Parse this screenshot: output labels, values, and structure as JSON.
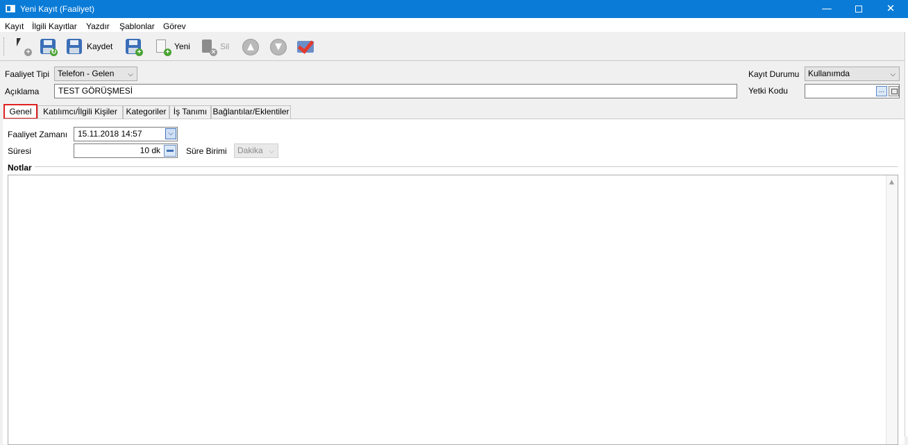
{
  "window": {
    "title": "Yeni Kayıt (Faaliyet)",
    "min": "—",
    "close": "✕"
  },
  "menu": [
    "Kayıt",
    "İlgili Kayıtlar",
    "Yazdır",
    "Şablonlar",
    "Görev"
  ],
  "toolbar": {
    "save_label": "Kaydet",
    "new_label": "Yeni",
    "delete_label": "Sil",
    "up": "▲",
    "down": "▼"
  },
  "header": {
    "activity_type_label": "Faaliyet Tipi",
    "activity_type_value": "Telefon - Gelen",
    "description_label": "Açıklama",
    "description_value": "TEST GÖRÜŞMESİ",
    "record_status_label": "Kayıt Durumu",
    "record_status_value": "Kullanımda",
    "auth_code_label": "Yetki Kodu",
    "auth_code_value": "",
    "dots": "..."
  },
  "tabs": [
    "Genel",
    "Katılımcı/İlgili Kişiler",
    "Kategoriler",
    "İş Tanımı",
    "Bağlantılar/Eklentiler"
  ],
  "general": {
    "activity_time_label": "Faaliyet Zamanı",
    "activity_time_value": "15.11.2018 14:57",
    "duration_label": "Süresi",
    "duration_value": "10 dk",
    "duration_unit_label": "Süre Birimi",
    "duration_unit_value": "Dakika",
    "notes_label": "Notlar"
  },
  "dropdown_arrow": "⌵",
  "colors": {
    "titlebar": "#0a7bd7",
    "active_tab_border": "#e02020"
  }
}
